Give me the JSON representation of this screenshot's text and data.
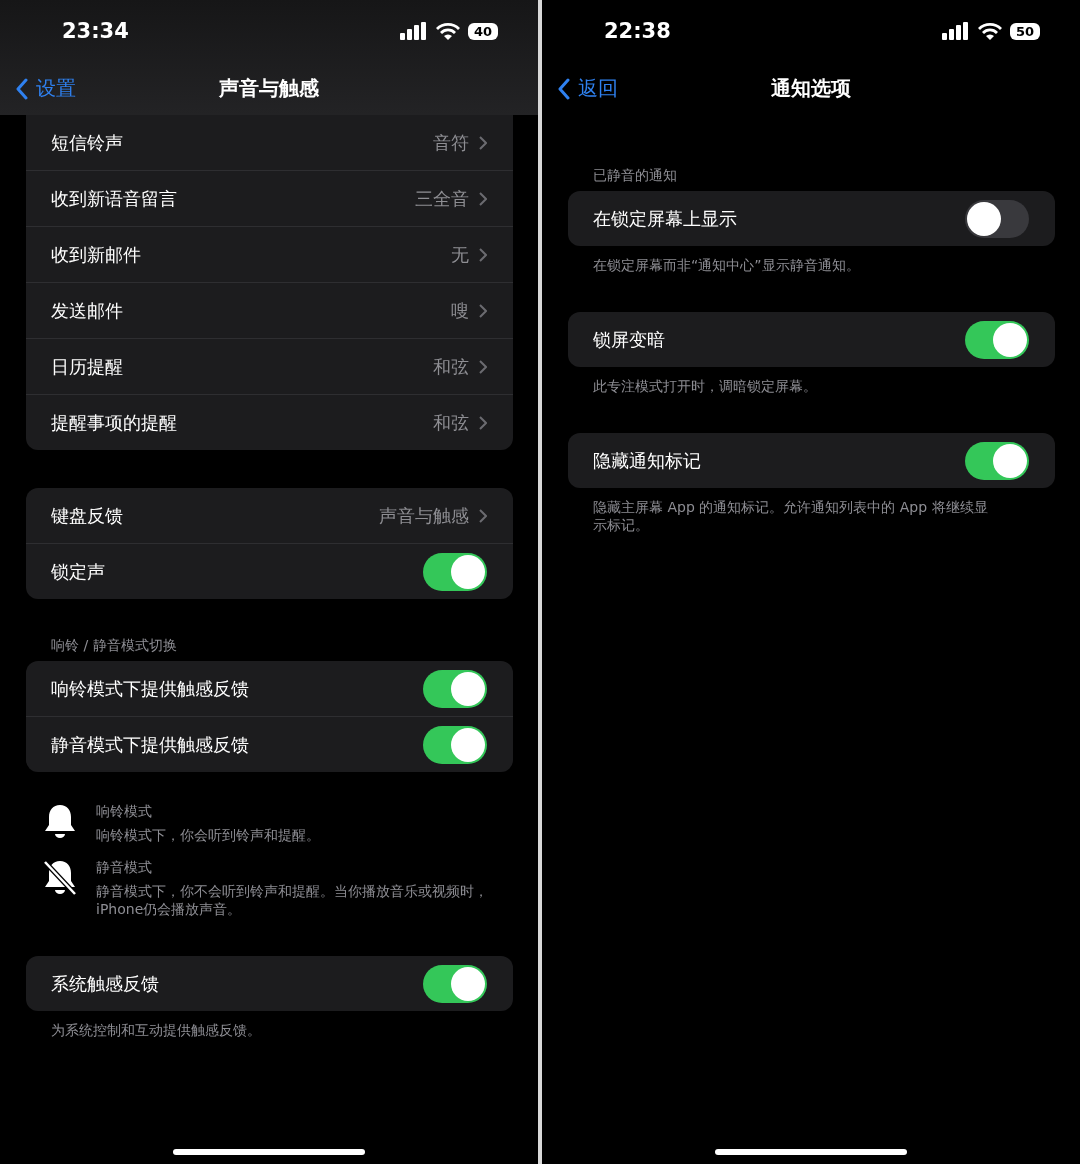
{
  "panels": [
    {
      "status_bar": {
        "time": "23:34",
        "battery": "40"
      },
      "nav": {
        "back": "设置",
        "title": "声音与触感",
        "translucent": true
      },
      "sections": [
        {
          "rows": [
            {
              "kind": "value",
              "label": "短信铃声",
              "value": "音符"
            },
            {
              "kind": "value",
              "label": "收到新语音留言",
              "value": "三全音"
            },
            {
              "kind": "value",
              "label": "收到新邮件",
              "value": "无"
            },
            {
              "kind": "value",
              "label": "发送邮件",
              "value": "嗖"
            },
            {
              "kind": "value",
              "label": "日历提醒",
              "value": "和弦"
            },
            {
              "kind": "value",
              "label": "提醒事项的提醒",
              "value": "和弦"
            }
          ]
        },
        {
          "rows": [
            {
              "kind": "value",
              "label": "键盘反馈",
              "value": "声音与触感"
            },
            {
              "kind": "toggle",
              "label": "锁定声",
              "on": true
            }
          ]
        },
        {
          "header": "响铃 / 静音模式切换",
          "rows": [
            {
              "kind": "toggle",
              "label": "响铃模式下提供触感反馈",
              "on": true
            },
            {
              "kind": "toggle",
              "label": "静音模式下提供触感反馈",
              "on": true
            }
          ],
          "modes": [
            {
              "kind": "ring",
              "title": "响铃模式",
              "text": "响铃模式下，你会听到铃声和提醒。"
            },
            {
              "kind": "silent",
              "title": "静音模式",
              "text": "静音模式下，你不会听到铃声和提醒。当你播放音乐或视频时，iPhone仍会播放声音。"
            }
          ]
        },
        {
          "rows": [
            {
              "kind": "toggle",
              "label": "系统触感反馈",
              "on": true
            }
          ],
          "footer": "为系统控制和互动提供触感反馈。"
        }
      ]
    },
    {
      "status_bar": {
        "time": "22:38",
        "battery": "50"
      },
      "nav": {
        "back": "返回",
        "title": "通知选项",
        "translucent": false
      },
      "sections": [
        {
          "header": "已静音的通知",
          "rows": [
            {
              "kind": "toggle",
              "label": "在锁定屏幕上显示",
              "on": false
            }
          ],
          "footer": "在锁定屏幕而非“通知中心”显示静音通知。"
        },
        {
          "rows": [
            {
              "kind": "toggle",
              "label": "锁屏变暗",
              "on": true
            }
          ],
          "footer": "此专注模式打开时，调暗锁定屏幕。"
        },
        {
          "rows": [
            {
              "kind": "toggle",
              "label": "隐藏通知标记",
              "on": true
            }
          ],
          "footer": "隐藏主屏幕 App 的通知标记。允许通知列表中的 App 将继续显示标记。"
        }
      ]
    }
  ]
}
